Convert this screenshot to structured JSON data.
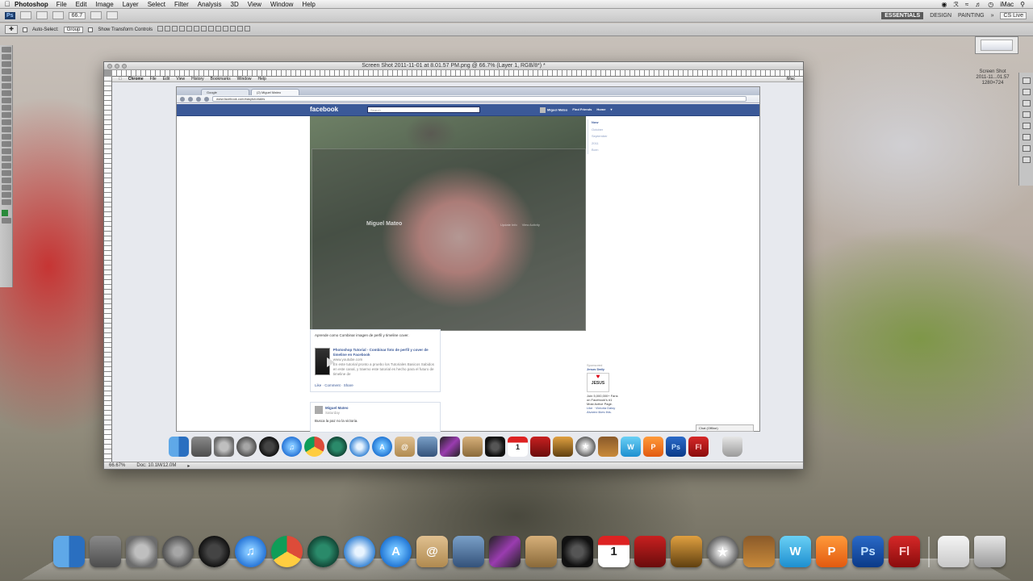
{
  "menubar": {
    "app_name": "Photoshop",
    "items": [
      "File",
      "Edit",
      "Image",
      "Layer",
      "Select",
      "Filter",
      "Analysis",
      "3D",
      "View",
      "Window",
      "Help"
    ],
    "computer_name": "iMac"
  },
  "appbar": {
    "logo": "Ps",
    "zoom": "66.7",
    "workspaces": [
      "ESSENTIALS",
      "DESIGN",
      "PAINTING"
    ],
    "cs_live": "CS Live"
  },
  "options": {
    "auto_select_label": "Auto-Select:",
    "auto_select_value": "Group",
    "show_transform_label": "Show Transform Controls"
  },
  "document": {
    "title": "Screen Shot 2011-11-01 at 8.01.57 PM.png @ 66.7% (Layer 1, RGB/8*) *",
    "status_zoom": "66.67%",
    "status_doc": "Doc: 10.1M/12.0M"
  },
  "desktop_file": {
    "name_line1": "Screen Shot",
    "name_line2": "2011-11...01.57",
    "name_line3": "1280×724"
  },
  "inner_menubar": {
    "items": [
      "Chrome",
      "File",
      "Edit",
      "View",
      "History",
      "Bookmarks",
      "Window",
      "Help"
    ],
    "right": "iMac"
  },
  "browser": {
    "tabs": [
      "Google",
      "(2) Miguel Mateo"
    ],
    "url": "www.facebook.com/easytutoriales"
  },
  "facebook": {
    "logo": "facebook",
    "search_placeholder": "Search",
    "user_name": "Miguel Mateo",
    "find_friends": "Find Friends",
    "home": "Home",
    "profile_name": "Miguel Mateo",
    "profile_links": [
      "Update Info",
      "View Activity"
    ],
    "timeline_nav": [
      "Now",
      "October",
      "September",
      "2011",
      "Born"
    ],
    "post_text": "Aprende como Combinar imagen de perfil y timeline cover.",
    "video_title": "Photoshop Tutorial - Combinar foto de perfil y cover de timeline en Facebook",
    "video_source": "www.youtube.com",
    "video_desc": "En este tutorial pronto a pruebo los Tutoriales Basicos Sabidos en este canal, y traemo este tutorial es hecho para el futuro de timeline de",
    "actions": "Like · Comment · Share",
    "post2_author": "Miguel Mateo",
    "post2_time": "Saturday",
    "post2_text": "Busca la paz no la victoria.",
    "sponsored_label": "Sponsored",
    "ad_title": "Jesus Daily",
    "ad_image_text": "JESUS",
    "ad_body": "Join 5,000,000+ Fans on Facebook's #1 Most Active Page.",
    "ad_like": "Like · Victoria Daisy Alvarez likes this.",
    "chat": "Chat (Offline)"
  },
  "inner_dock": {
    "calendar_day": "1",
    "w": "W",
    "p": "P",
    "ps": "Ps",
    "fl": "Fl"
  },
  "dock": {
    "calendar_day": "1",
    "w": "W",
    "p": "P",
    "ps": "Ps",
    "fl": "Fl"
  }
}
